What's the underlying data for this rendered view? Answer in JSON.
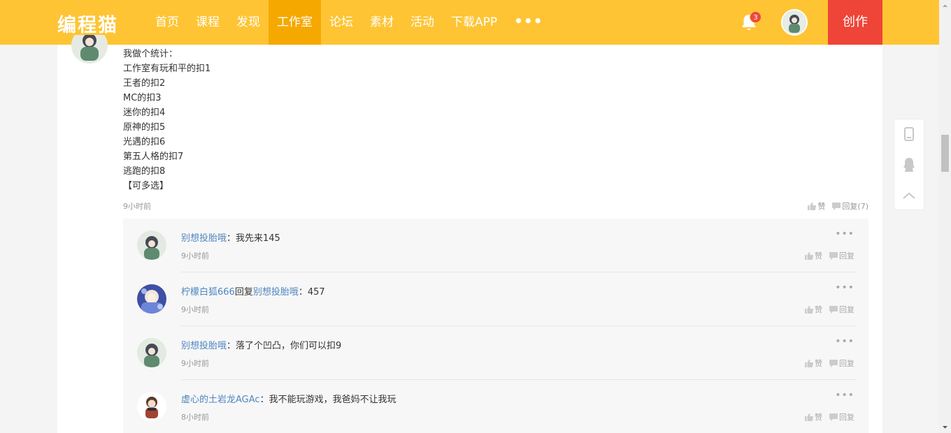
{
  "header": {
    "logo": "编程猫",
    "nav": [
      "首页",
      "课程",
      "发现",
      "工作室",
      "论坛",
      "素材",
      "活动",
      "下载APP"
    ],
    "active_index": 3,
    "more": "•••",
    "notification_count": "3",
    "create_label": "创作",
    "colors": {
      "bar": "#fec433",
      "active": "#f5a900",
      "create": "#ef4438"
    }
  },
  "post": {
    "lines": [
      "我做个统计：",
      "工作室有玩和平的扣1",
      "王者的扣2",
      "MC的扣3",
      "迷你的扣4",
      "原神的扣5",
      "光遇的扣6",
      "第五人格的扣7",
      "逃跑的扣8",
      "【可多选】"
    ],
    "time": "9小时前",
    "like_label": "赞",
    "reply_label": "回复(7)"
  },
  "replies": [
    {
      "author": "别想投胎哦",
      "reply_word": "",
      "target": "",
      "content": "：我先来145",
      "time": "9小时前",
      "like_label": "赞",
      "reply_label": "回复"
    },
    {
      "author": "柠檬白狐666",
      "reply_word": "回复",
      "target": "别想投胎哦",
      "content": "：457",
      "time": "9小时前",
      "like_label": "赞",
      "reply_label": "回复"
    },
    {
      "author": "别想投胎哦",
      "reply_word": "",
      "target": "",
      "content": "：落了个凹凸，你们可以扣9",
      "time": "9小时前",
      "like_label": "赞",
      "reply_label": "回复"
    },
    {
      "author": "虚心的土岩龙AGAc",
      "reply_word": "",
      "target": "",
      "content": "：我不能玩游戏，我爸妈不让我玩",
      "time": "8小时前",
      "like_label": "赞",
      "reply_label": "回复"
    }
  ],
  "more_dots": "•••",
  "side_tools": [
    "phone-icon",
    "qq-icon",
    "back-to-top-icon"
  ]
}
